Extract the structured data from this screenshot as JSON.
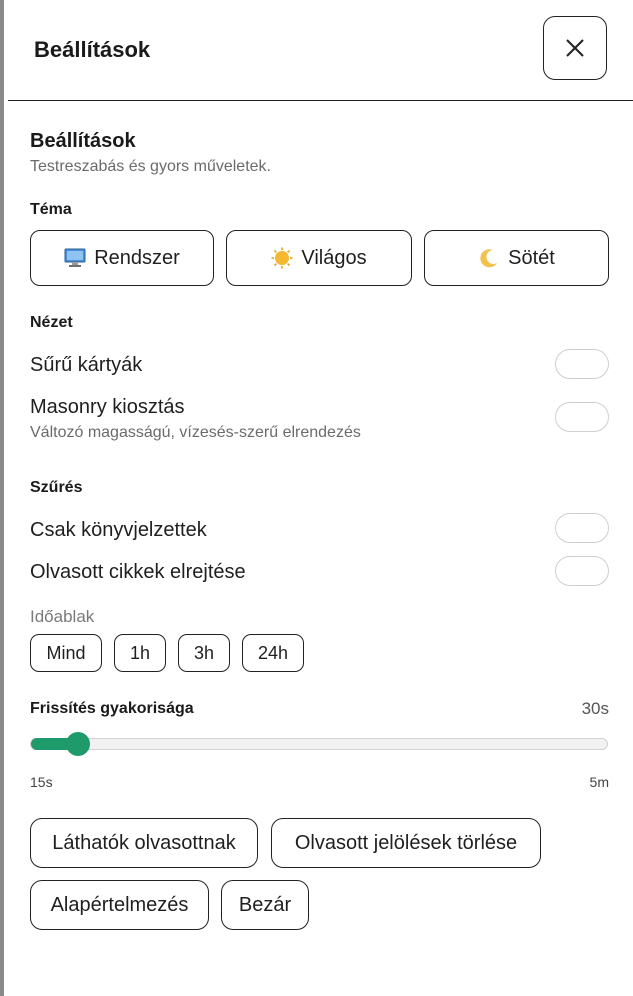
{
  "header": {
    "title": "Beállítások",
    "close_icon": "close-icon"
  },
  "intro": {
    "title": "Beállítások",
    "subtitle": "Testreszabás és gyors műveletek."
  },
  "theme": {
    "label": "Téma",
    "options": [
      {
        "label": "Rendszer",
        "icon": "monitor-icon",
        "emoji": "🖥️"
      },
      {
        "label": "Világos",
        "icon": "sun-icon",
        "emoji": "🌞"
      },
      {
        "label": "Sötét",
        "icon": "moon-icon",
        "emoji": "🌙"
      }
    ]
  },
  "view": {
    "label": "Nézet",
    "dense_cards": {
      "label": "Sűrű kártyák",
      "on": false
    },
    "masonry": {
      "label": "Masonry kiosztás",
      "hint": "Változó magasságú, vízesés-szerű elrendezés",
      "on": false
    }
  },
  "filter": {
    "label": "Szűrés",
    "bookmarked_only": {
      "label": "Csak könyvjelzettek",
      "on": false
    },
    "hide_read": {
      "label": "Olvasott cikkek elrejtése",
      "on": false
    },
    "timewindow": {
      "label": "Időablak",
      "options": [
        "Mind",
        "1h",
        "3h",
        "24h"
      ]
    }
  },
  "refresh": {
    "label": "Frissítés gyakorisága",
    "value": "30s",
    "min": "15s",
    "max": "5m",
    "fraction": 0.07
  },
  "actions": {
    "mark_visible_read": "Láthatók olvasottnak",
    "clear_read_marks": "Olvasott jelölések törlése",
    "reset_defaults": "Alapértelmezés",
    "close": "Bezár"
  },
  "colors": {
    "accent": "#1f9a6b",
    "border": "#222222",
    "muted": "#6b6b6b"
  }
}
